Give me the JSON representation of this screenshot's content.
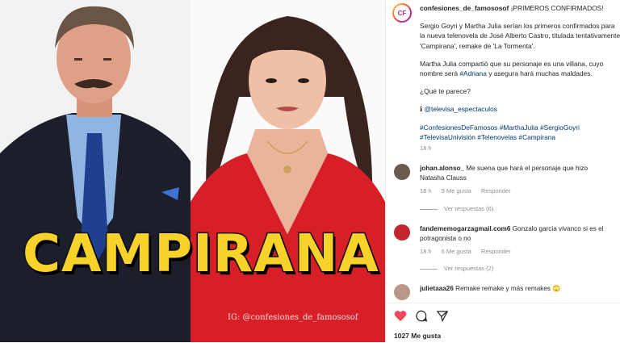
{
  "image": {
    "headline": "CAMPIRANA",
    "watermark": "IG: @confesiones_de_famososof"
  },
  "post": {
    "avatar_initials": "CF",
    "username": "confesiones_de_famososof",
    "caption_title": "¡PRIMEROS CONFIRMADOS!",
    "para1": "Sergio Goyri y Martha Julia serían los primeros confirmados para la nueva telenovela de José Alberto Castro, titulada tentativamente 'Campirana', remake de 'La Tormenta'.",
    "para2_a": "Martha Julia compartió que su personaje es una villana, cuyo nombre será ",
    "para2_tag": "#Adriana",
    "para2_b": " y asegura hará muchas maldades.",
    "question": "¿Qué te parece?",
    "source_prefix": "ℹ ",
    "source_mention": "@televisa_espectaculos",
    "hashtags_line1": "#ConfesionesDeFamosos #MarthaJulia #SergioGoyri",
    "hashtags_line2": "#TelevisaUnivisión #Telenovelas #Campirana",
    "time": "18 h"
  },
  "comments": [
    {
      "username": "johan.alonso_",
      "text": "Me suena que hará el personaje que hizo Natasha Clauss",
      "time": "18 h",
      "likes": "9 Me gusta",
      "reply": "Responder",
      "view_replies": "Ver respuestas (6)",
      "avatar_color": "#6b5a4e"
    },
    {
      "username": "fandememogarzagmail.com6",
      "text": "Gonzalo garcia vivanco si es el potragonista o no",
      "time": "18 h",
      "likes": "6 Me gusta",
      "reply": "Responder",
      "view_replies": "Ver respuestas (2)",
      "avatar_color": "#c0262d"
    },
    {
      "username": "julietaaa26",
      "text": "Remake remake y más remakes 🙄",
      "avatar_color": "#b99685"
    }
  ],
  "actions": {
    "likes": "1027 Me gusta"
  },
  "colors": {
    "heart": "#ed4956",
    "link": "#00376b",
    "muted": "#8e8e8e",
    "headline": "#f7d22a"
  }
}
